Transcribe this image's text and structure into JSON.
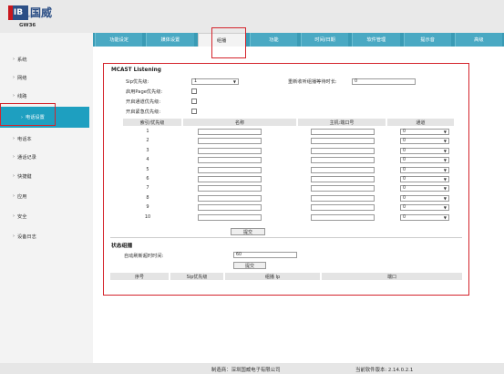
{
  "brand": {
    "logo_text": "IB",
    "name_cn": "国威",
    "sub": "GUOWEI",
    "model": "GW36"
  },
  "tabs": [
    "功能设定",
    "媒体设置",
    "组播",
    "功能",
    "时间/日期",
    "软件管理",
    "提示音",
    "高级"
  ],
  "active_tab_index": 2,
  "sidebar": [
    {
      "label": "系统"
    },
    {
      "label": "网络"
    },
    {
      "label": "线路"
    },
    {
      "label": "电话设置",
      "active": true
    },
    {
      "label": "电话本"
    },
    {
      "label": "通话记录"
    },
    {
      "label": "快捷键"
    },
    {
      "label": "应用"
    },
    {
      "label": "安全"
    },
    {
      "label": "设备日志"
    }
  ],
  "mcast": {
    "title": "MCAST Listening",
    "sip_priority_label": "Sip优先级:",
    "sip_priority_value": "1",
    "page_priority_label": "启用Page优先级:",
    "page_priority_checked": false,
    "normal_priority_label": "开启通道优先级:",
    "normal_priority_checked": false,
    "emergency_priority_label": "开启紧急优先级:",
    "emergency_priority_checked": false,
    "wait_label": "重新收听组播等待时长:",
    "wait_value": "0",
    "columns": [
      "索引/优先级",
      "名称",
      "主机:端口号",
      "通道"
    ],
    "rows": [
      {
        "index": "1",
        "name": "",
        "host": "",
        "channel": "0"
      },
      {
        "index": "2",
        "name": "",
        "host": "",
        "channel": "0"
      },
      {
        "index": "3",
        "name": "",
        "host": "",
        "channel": "0"
      },
      {
        "index": "4",
        "name": "",
        "host": "",
        "channel": "0"
      },
      {
        "index": "5",
        "name": "",
        "host": "",
        "channel": "0"
      },
      {
        "index": "6",
        "name": "",
        "host": "",
        "channel": "0"
      },
      {
        "index": "7",
        "name": "",
        "host": "",
        "channel": "0"
      },
      {
        "index": "8",
        "name": "",
        "host": "",
        "channel": "0"
      },
      {
        "index": "9",
        "name": "",
        "host": "",
        "channel": "0"
      },
      {
        "index": "10",
        "name": "",
        "host": "",
        "channel": "0"
      }
    ],
    "submit_label": "提交"
  },
  "status": {
    "title": "状态组播",
    "refresh_label": "自动刷新超时时间:",
    "refresh_value": "60",
    "submit_label": "提交",
    "columns": [
      "序号",
      "Sip优先级",
      "组播 Ip",
      "端口"
    ]
  },
  "footer": {
    "maker": "制造商：深圳国威电子有限公司",
    "version": "当前软件版本: 2.14.0.2.1"
  }
}
